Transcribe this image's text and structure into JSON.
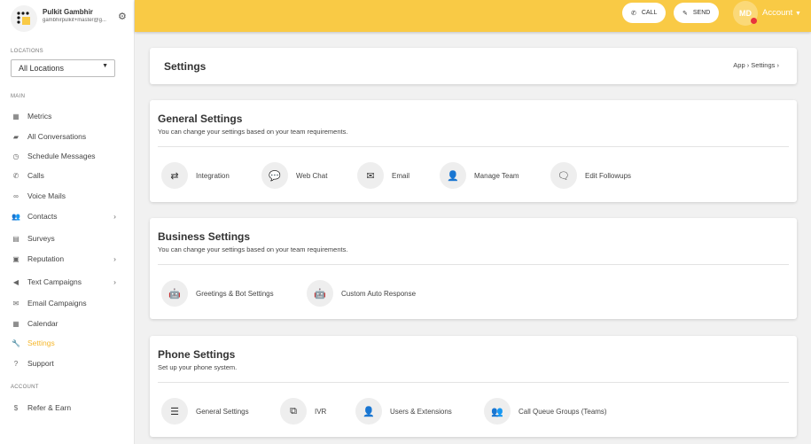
{
  "user": {
    "name": "Pulkit Gambhir",
    "email": "gambhirpulkit+master@g..."
  },
  "locations": {
    "label": "LOCATIONS",
    "selected": "All Locations"
  },
  "sidebar": {
    "main_label": "MAIN",
    "account_label": "ACCOUNT",
    "items": [
      {
        "label": "Metrics",
        "icon": "chart-icon",
        "glyph": "▦"
      },
      {
        "label": "All Conversations",
        "icon": "chat-icon",
        "glyph": "▰"
      },
      {
        "label": "Schedule Messages",
        "icon": "clock-icon",
        "glyph": "◷"
      },
      {
        "label": "Calls",
        "icon": "phone-icon",
        "glyph": "✆"
      },
      {
        "label": "Voice Mails",
        "icon": "voicemail-icon",
        "glyph": "∞"
      },
      {
        "label": "Contacts",
        "icon": "people-icon",
        "glyph": "👥"
      },
      {
        "label": "Surveys",
        "icon": "document-icon",
        "glyph": "▤"
      },
      {
        "label": "Reputation",
        "icon": "star-box-icon",
        "glyph": "▣"
      },
      {
        "label": "Text Campaigns",
        "icon": "megaphone-icon",
        "glyph": "◀"
      },
      {
        "label": "Email Campaigns",
        "icon": "mail-icon",
        "glyph": "✉"
      },
      {
        "label": "Calendar",
        "icon": "calendar-icon",
        "glyph": "▦"
      },
      {
        "label": "Settings",
        "icon": "wrench-icon",
        "glyph": "🔧"
      },
      {
        "label": "Support",
        "icon": "help-icon",
        "glyph": "?"
      }
    ],
    "account_items": [
      {
        "label": "Refer & Earn",
        "icon": "dollar-icon",
        "glyph": "$"
      }
    ]
  },
  "topbar": {
    "call": "CALL",
    "send": "SEND",
    "initials": "MD",
    "account": "Account"
  },
  "header": {
    "title": "Settings",
    "crumb_app": "App",
    "crumb_current": "Settings"
  },
  "sections": [
    {
      "title": "General Settings",
      "subtitle": "You can change your settings based on your team requirements.",
      "options": [
        {
          "label": "Integration",
          "icon": "integration-icon",
          "glyph": "⇄"
        },
        {
          "label": "Web Chat",
          "icon": "webchat-icon",
          "glyph": "💬"
        },
        {
          "label": "Email",
          "icon": "email-settings-icon",
          "glyph": "✉"
        },
        {
          "label": "Manage Team",
          "icon": "add-user-icon",
          "glyph": "👤"
        },
        {
          "label": "Edit Followups",
          "icon": "followups-icon",
          "glyph": "🗨"
        }
      ]
    },
    {
      "title": "Business Settings",
      "subtitle": "You can change your settings based on your team requirements.",
      "options": [
        {
          "label": "Greetings & Bot Settings",
          "icon": "bot-icon",
          "glyph": "🤖"
        },
        {
          "label": "Custom Auto Response",
          "icon": "auto-response-icon",
          "glyph": "🤖"
        }
      ]
    },
    {
      "title": "Phone Settings",
      "subtitle": "Set up your phone system.",
      "options": [
        {
          "label": "General Settings",
          "icon": "sliders-icon",
          "glyph": "☰"
        },
        {
          "label": "IVR",
          "icon": "ivr-icon",
          "glyph": "⧉"
        },
        {
          "label": "Users & Extensions",
          "icon": "user-icon",
          "glyph": "👤"
        },
        {
          "label": "Call Queue Groups (Teams)",
          "icon": "group-icon",
          "glyph": "👥"
        }
      ]
    }
  ]
}
